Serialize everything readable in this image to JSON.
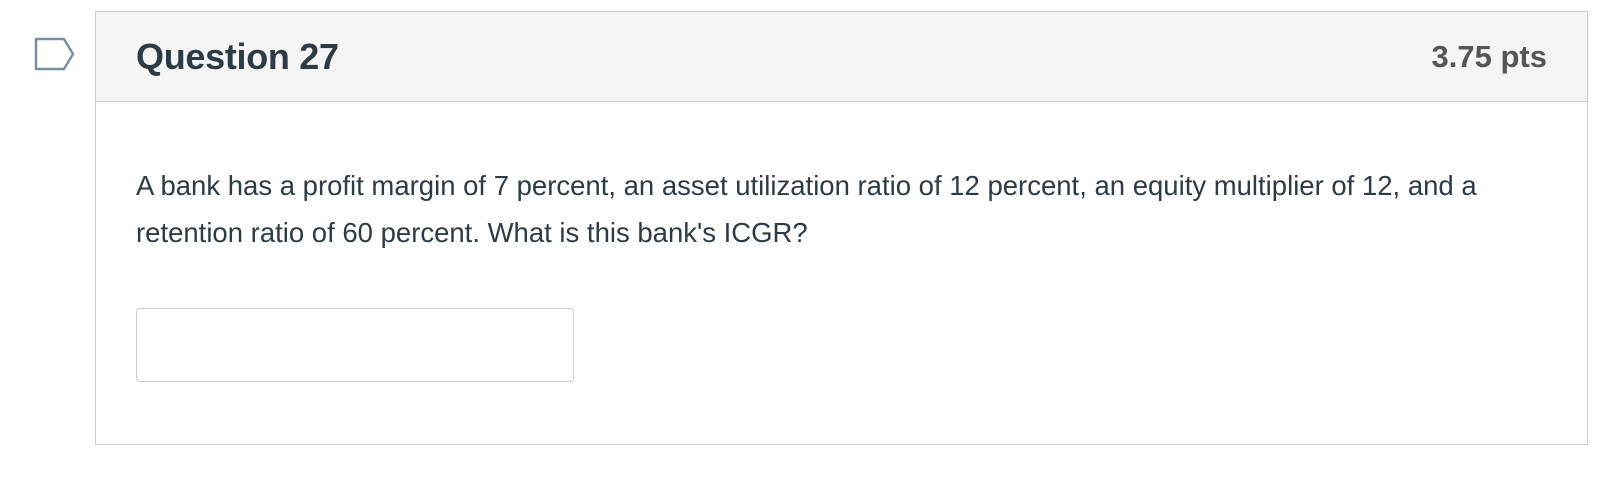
{
  "question": {
    "title": "Question 27",
    "points": "3.75 pts",
    "text": "A bank has a profit margin of 7 percent, an asset utilization ratio of 12 percent, an equity multiplier of 12, and a retention ratio of 60 percent. What is this bank's ICGR?",
    "answer_value": "",
    "flag_icon": "flag-question-icon"
  },
  "colors": {
    "header_bg": "#f5f5f5",
    "border": "#c7cdd1",
    "text": "#2d3b45",
    "flag_stroke": "#7a8fa6"
  }
}
